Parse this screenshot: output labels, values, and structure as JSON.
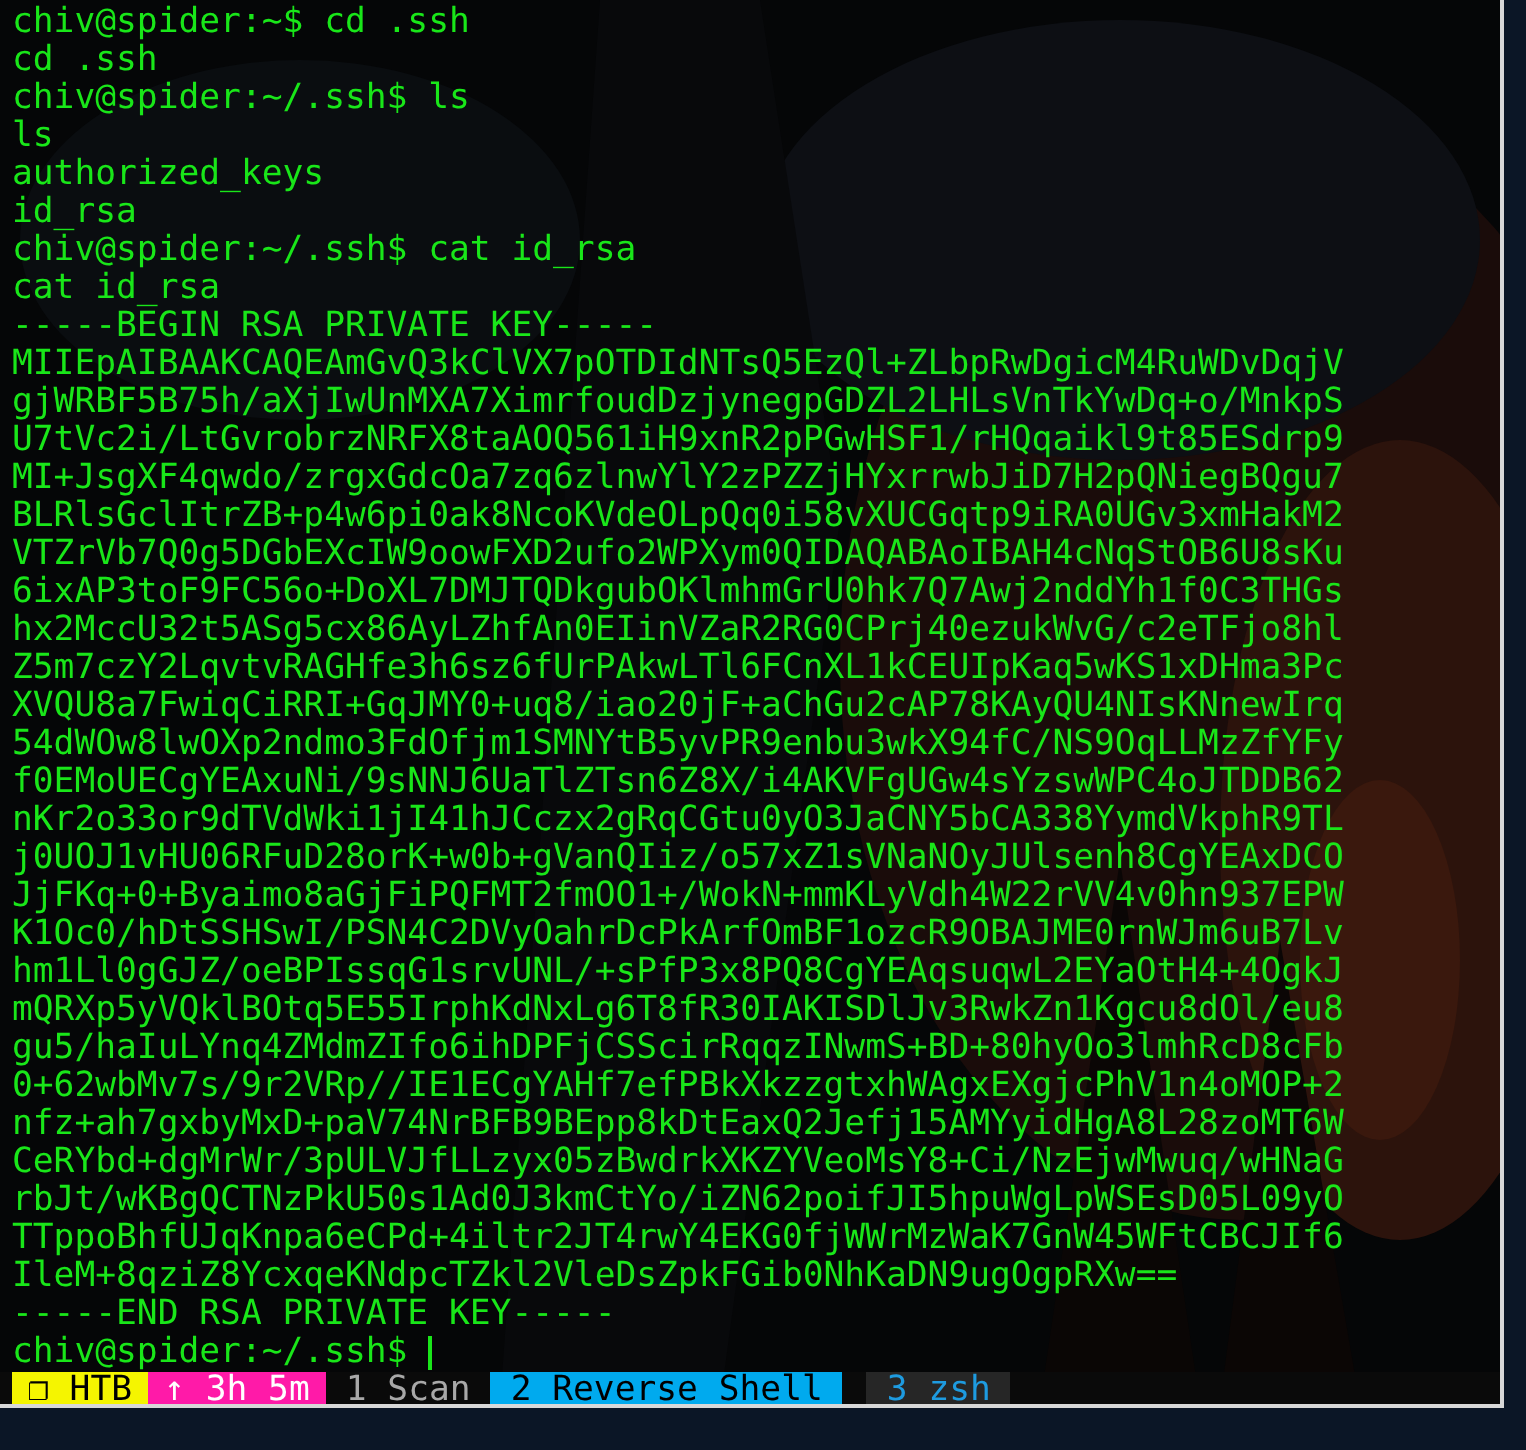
{
  "terminal": {
    "lines": [
      "chiv@spider:~$ cd .ssh",
      "cd .ssh",
      "chiv@spider:~/.ssh$ ls",
      "ls",
      "authorized_keys",
      "id_rsa",
      "chiv@spider:~/.ssh$ cat id_rsa",
      "cat id_rsa",
      "-----BEGIN RSA PRIVATE KEY-----",
      "MIIEpAIBAAKCAQEAmGvQ3kClVX7pOTDIdNTsQ5EzQl+ZLbpRwDgicM4RuWDvDqjV",
      "gjWRBF5B75h/aXjIwUnMXA7XimrfoudDzjynegpGDZL2LHLsVnTkYwDq+o/MnkpS",
      "U7tVc2i/LtGvrobrzNRFX8taAOQ561iH9xnR2pPGwHSF1/rHQqaikl9t85ESdrp9",
      "MI+JsgXF4qwdo/zrgxGdcOa7zq6zlnwYlY2zPZZjHYxrrwbJiD7H2pQNiegBQgu7",
      "BLRlsGclItrZB+p4w6pi0ak8NcoKVdeOLpQq0i58vXUCGqtp9iRA0UGv3xmHakM2",
      "VTZrVb7Q0g5DGbEXcIW9oowFXD2ufo2WPXym0QIDAQABAoIBAH4cNqStOB6U8sKu",
      "6ixAP3toF9FC56o+DoXL7DMJTQDkgubOKlmhmGrU0hk7Q7Awj2nddYh1f0C3THGs",
      "hx2MccU32t5ASg5cx86AyLZhfAn0EIinVZaR2RG0CPrj40ezukWvG/c2eTFjo8hl",
      "Z5m7czY2LqvtvRAGHfe3h6sz6fUrPAkwLTl6FCnXL1kCEUIpKaq5wKS1xDHma3Pc",
      "XVQU8a7FwiqCiRRI+GqJMY0+uq8/iao20jF+aChGu2cAP78KAyQU4NIsKNnewIrq",
      "54dWOw8lwOXp2ndmo3FdOfjm1SMNYtB5yvPR9enbu3wkX94fC/NS9OqLLMzZfYFy",
      "f0EMoUECgYEAxuNi/9sNNJ6UaTlZTsn6Z8X/i4AKVFgUGw4sYzswWPC4oJTDDB62",
      "nKr2o33or9dTVdWki1jI41hJCczx2gRqCGtu0yO3JaCNY5bCA338YymdVkphR9TL",
      "j0UOJ1vHU06RFuD28orK+w0b+gVanQIiz/o57xZ1sVNaNOyJUlsenh8CgYEAxDCO",
      "JjFKq+0+Byaimo8aGjFiPQFMT2fmOO1+/WokN+mmKLyVdh4W22rVV4v0hn937EPW",
      "K1Oc0/hDtSSHSwI/PSN4C2DVyOahrDcPkArfOmBF1ozcR9OBAJME0rnWJm6uB7Lv",
      "hm1Ll0gGJZ/oeBPIssqG1srvUNL/+sPfP3x8PQ8CgYEAqsuqwL2EYaOtH4+4OgkJ",
      "mQRXp5yVQklBOtq5E55IrphKdNxLg6T8fR30IAKISDlJv3RwkZn1Kgcu8dOl/eu8",
      "gu5/haIuLYnq4ZMdmZIfo6ihDPFjCSScirRqqzINwmS+BD+80hyOo3lmhRcD8cFb",
      "0+62wbMv7s/9r2VRp//IE1ECgYAHf7efPBkXkzzgtxhWAgxEXgjcPhV1n4oMOP+2",
      "nfz+ah7gxbyMxD+paV74NrBFB9BEpp8kDtEaxQ2Jefj15AMYyidHgA8L28zoMT6W",
      "CeRYbd+dgMrWr/3pULVJfLLzyx05zBwdrkXKZYVeoMsY8+Ci/NzEjwMwuq/wHNaG",
      "rbJt/wKBgQCTNzPkU50s1Ad0J3kmCtYo/iZN62poifJI5hpuWgLpWSEsD05L09yO",
      "TTppoBhfUJqKnpa6eCPd+4iltr2JT4rwY4EKG0fjWWrMzWaK7GnW45WFtCBCJIf6",
      "IleM+8qziZ8YcxqeKNdpcTZkl2VleDsZpkFGib0NhKaDN9ugOgpRXw==",
      "-----END RSA PRIVATE KEY-----"
    ],
    "prompt": {
      "text": "chiv@spider:~/.ssh$",
      "cursor": true
    }
  },
  "status_bar": {
    "session": "❐ HTB",
    "uptime": "↑ 3h 5m",
    "windows": [
      {
        "label": "1 Scan",
        "selected": false,
        "previous": false
      },
      {
        "label": "2 Reverse Shell",
        "selected": true,
        "previous": false
      },
      {
        "label": "3 zsh",
        "selected": false,
        "previous": true
      }
    ]
  }
}
